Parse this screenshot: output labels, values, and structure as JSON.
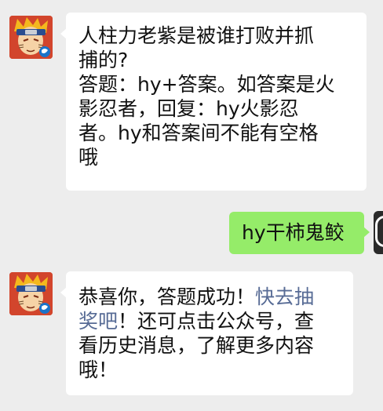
{
  "messages": [
    {
      "sender": "received",
      "avatar_icon": "naruto-avatar-icon",
      "lines": [
        "人柱力老紫是被谁打败并抓",
        "捕的?",
        "答题：hy+答案。如答案是火",
        "影忍者，回复：hy火影忍",
        "者。hy和答案间不能有空格",
        "哦"
      ]
    },
    {
      "sender": "sent",
      "text": "hy干柿鬼鲛"
    },
    {
      "sender": "received",
      "avatar_icon": "naruto-avatar-icon",
      "line1_before": "恭喜你，答题成功！",
      "line1_link": "快去抽",
      "line2_link": "奖吧",
      "line2_after": "！还可点击公众号，查",
      "line3": "看历史消息，了解更多内容",
      "line4": "哦！"
    }
  ],
  "colors": {
    "background": "#ededed",
    "received_bubble": "#ffffff",
    "sent_bubble": "#95ec69",
    "link": "#576b95"
  }
}
